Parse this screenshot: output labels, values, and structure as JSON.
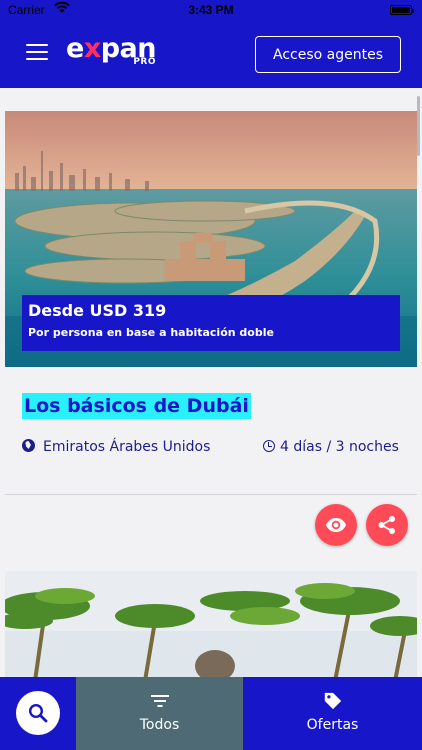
{
  "status_bar": {
    "carrier": "Carrier",
    "time": "3:43 PM"
  },
  "header": {
    "logo_text": "expan",
    "logo_sub": "PRO",
    "agents_button": "Acceso agentes"
  },
  "card": {
    "price": "Desde USD 319",
    "price_note": "Por persona en base a habitación doble",
    "title": "Los básicos de Dubái",
    "location": "Emiratos Árabes Unidos",
    "duration": "4 días / 3 noches"
  },
  "bottom_nav": {
    "tabs": [
      {
        "label": "Todos",
        "icon": "filter-icon",
        "selected": true
      },
      {
        "label": "Ofertas",
        "icon": "tag-icon",
        "selected": false
      }
    ]
  },
  "colors": {
    "brand_blue": "#1717c9",
    "accent_red": "#ff4b57",
    "highlight_cyan": "#29f0ff",
    "tab_selected": "#4e6a74"
  }
}
